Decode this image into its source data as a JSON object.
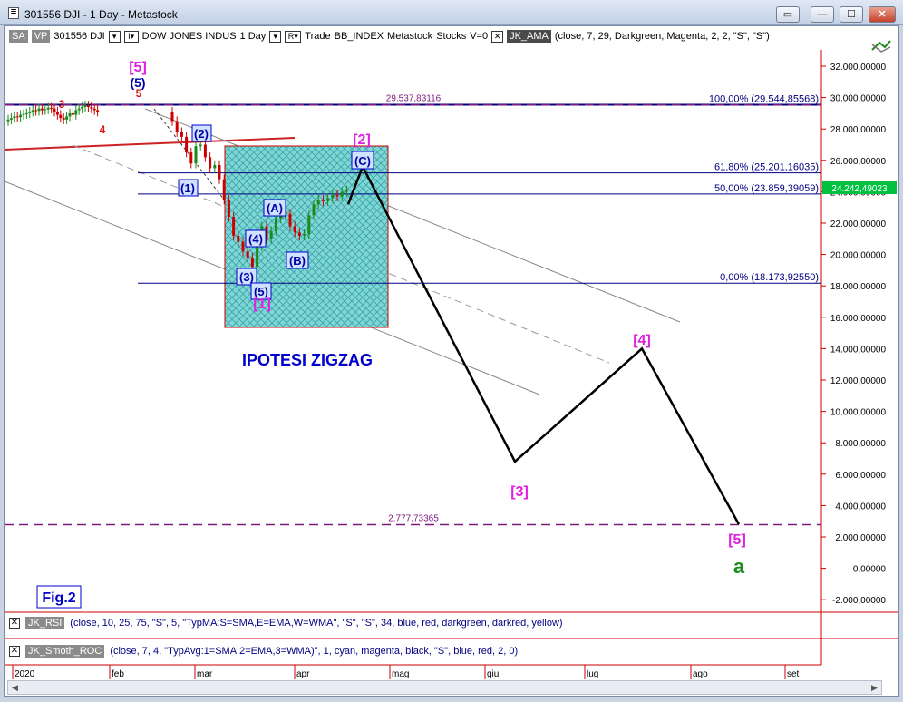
{
  "window": {
    "title": "301556 DJI - 1 Day - Metastock",
    "buttons": [
      "▭",
      "—",
      "☐",
      "✕"
    ]
  },
  "toolbar": {
    "sa": "SA",
    "vp": "VP",
    "symbol": "301556 DJI",
    "dd1": "▾",
    "i_btn": "I▾",
    "name": "DOW JONES INDUS",
    "period": "1 Day",
    "dd2": "▾",
    "r_btn": "R▾",
    "trade": "Trade",
    "bb": "BB_INDEX",
    "source": "Metastock",
    "stocks": "Stocks",
    "v": "V=0",
    "x": "✕",
    "indicator": "JK_AMA",
    "params": "(close, 7, 29, Darkgreen, Magenta, 2, 2, \"S\", \"S\")"
  },
  "chart_data": {
    "type": "candlestick",
    "y_axis": {
      "ticks": [
        "32.000,00000",
        "30.000,00000",
        "28.000,00000",
        "26.000,00000",
        "24.000,00000",
        "22.000,00000",
        "20.000,00000",
        "18.000,00000",
        "16.000,00000",
        "14.000,00000",
        "12.000,00000",
        "10.000,00000",
        "8.000,00000",
        "6.000,00000",
        "4.000,00000",
        "2.000,00000",
        "0,00000",
        "-2.000,00000"
      ],
      "min": -2000,
      "max": 32000,
      "last_value": "24.242,49023",
      "last_value_color": "#00c040"
    },
    "x_axis": {
      "ticks": [
        "2020",
        "feb",
        "mar",
        "apr",
        "mag",
        "giu",
        "lug",
        "ago",
        "set"
      ]
    },
    "fib_levels": [
      {
        "label": "100,00% (29.544,85568)",
        "value": 29544.86
      },
      {
        "label": "61,80% (25.201,16035)",
        "value": 25201.16
      },
      {
        "label": "50,00% (23.859,39059)",
        "value": 23859.39
      },
      {
        "label": "0,00% (18.173,92550)",
        "value": 18173.93
      }
    ],
    "dashed_levels": [
      {
        "label": "29.537,83116",
        "value": 29537.83
      },
      {
        "label": "2.777,73365",
        "value": 2777.73
      }
    ],
    "wave_labels": {
      "top_5": "[5]",
      "top_5b": "(5)",
      "top_5r": "5",
      "w3": "3",
      "w4": "4",
      "w1": "(1)",
      "w2": "(2)",
      "wA": "(A)",
      "wB": "(B)",
      "wC": "(C)",
      "w3s": "(3)",
      "w4s": "(4)",
      "w5s": "(5)",
      "m1": "[1]",
      "m2": "[2]",
      "m3": "[3]",
      "m4": "[4]",
      "m5": "[5]",
      "a": "a"
    },
    "projection": [
      {
        "date": "apr-22",
        "value": 23200
      },
      {
        "date": "apr-27",
        "value": 25600
      },
      {
        "date": "giu-10",
        "value": 6800
      },
      {
        "date": "lug-20",
        "value": 14000
      },
      {
        "date": "ago-25",
        "value": 2800
      }
    ],
    "annotation": "IPOTESI ZIGZAG",
    "figure_label": "Fig.2"
  },
  "indicators": [
    {
      "name": "JK_RSI",
      "params": "(close, 10, 25, 75, \"S\", 5, \"TypMA:S=SMA,E=EMA,W=WMA\", \"S\", \"S\", 34, blue, red, darkgreen, darkred, yellow)"
    },
    {
      "name": "JK_Smoth_ROC",
      "params": "(close, 7, 4, \"TypAvg:1=SMA,2=EMA,3=WMA)\", 1, cyan, magenta, black, \"S\", blue, red, 2, 0)"
    }
  ],
  "colors": {
    "fib_line": "#000080",
    "box_fill": "#66cccc",
    "box_border": "#cc0000",
    "magenta": "#e020e0",
    "wave_blue": "#0000cc"
  }
}
